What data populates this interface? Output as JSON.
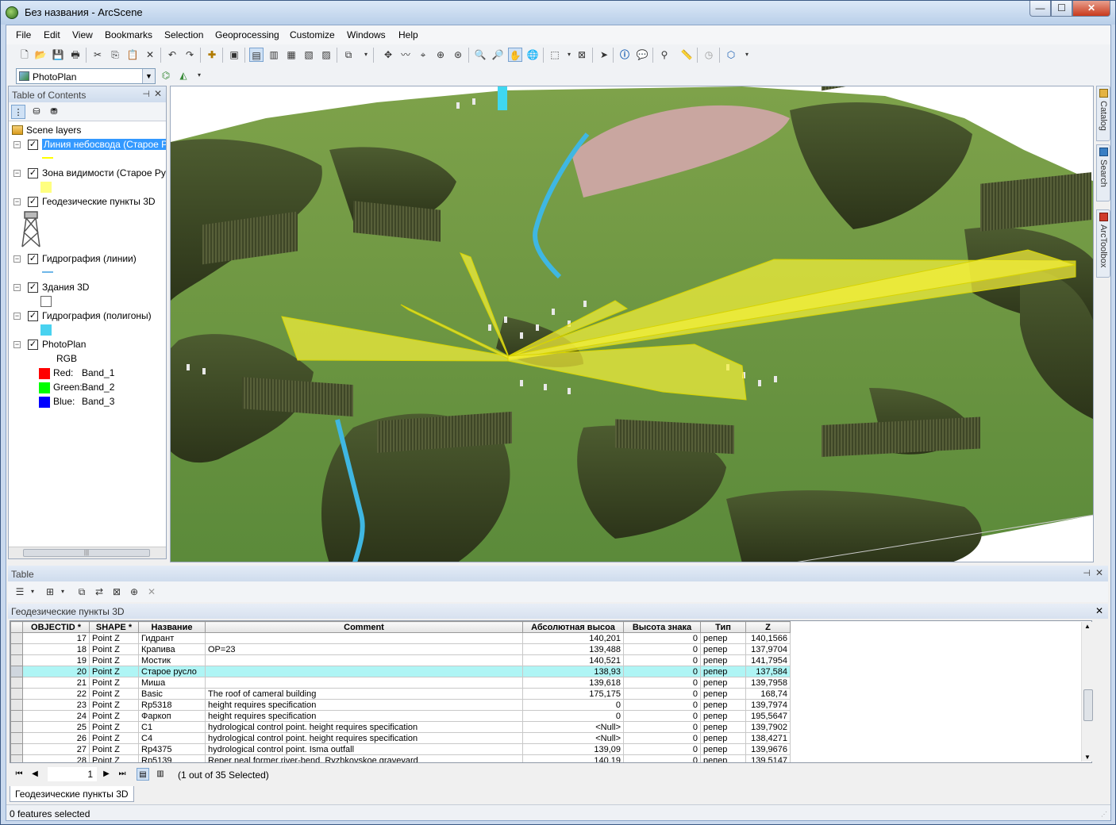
{
  "window": {
    "title": "Без названия - ArcScene",
    "minimize": "—",
    "maximize": "☐",
    "close": "✕"
  },
  "menubar": [
    "File",
    "Edit",
    "View",
    "Bookmarks",
    "Selection",
    "Geoprocessing",
    "Customize",
    "Windows",
    "Help"
  ],
  "layer_selector": {
    "value": "PhotoPlan"
  },
  "toc": {
    "title": "Table of Contents",
    "pin": "⊣",
    "close": "✕",
    "root": "Scene layers",
    "layers": [
      {
        "name": "Линия небосвода (Старое Р",
        "checked": true,
        "selected": true,
        "symbol": "line",
        "color": "#ffff00"
      },
      {
        "name": "Зона видимости (Старое Ру",
        "checked": true,
        "symbol": "fill",
        "color": "#ffff80"
      },
      {
        "name": "Геодезические пункты 3D",
        "checked": true,
        "symbol": "tower",
        "color": "#888888"
      },
      {
        "name": "Гидрография (линии)",
        "checked": true,
        "symbol": "line",
        "color": "#6fb7e8"
      },
      {
        "name": "Здания 3D",
        "checked": true,
        "symbol": "box",
        "color": "#ffffff"
      },
      {
        "name": "Гидрография (полигоны)",
        "checked": true,
        "symbol": "fill",
        "color": "#49d2f0"
      },
      {
        "name": "PhotoPlan",
        "checked": true,
        "symbol": "raster",
        "color": ""
      }
    ],
    "raster": {
      "label": "RGB",
      "bands": [
        {
          "channel": "Red:",
          "band": "Band_1",
          "color": "#ff0000"
        },
        {
          "channel": "Green:",
          "band": "Band_2",
          "color": "#00ff00"
        },
        {
          "channel": "Blue:",
          "band": "Band_3",
          "color": "#0000ff"
        }
      ]
    }
  },
  "right_dock": {
    "tabs": [
      "Catalog",
      "Search",
      "ArcToolbox"
    ]
  },
  "table_pane": {
    "title": "Table",
    "pin": "⊣",
    "close": "✕",
    "layer_title": "Геодезические пункты 3D",
    "columns": [
      "OBJECTID *",
      "SHAPE *",
      "Название",
      "Comment",
      "Абсолютная высоа",
      "Высота знака",
      "Тип",
      "Z"
    ],
    "rows": [
      [
        "17",
        "Point Z",
        "Гидрант",
        "",
        "140,201",
        "0",
        "репер",
        "140,1566"
      ],
      [
        "18",
        "Point Z",
        "Крапива",
        "OP=23",
        "139,488",
        "0",
        "репер",
        "137,9704"
      ],
      [
        "19",
        "Point Z",
        "Мостик",
        "",
        "140,521",
        "0",
        "репер",
        "141,7954"
      ],
      [
        "20",
        "Point Z",
        "Старое русло",
        "",
        "138,93",
        "0",
        "репер",
        "137,584"
      ],
      [
        "21",
        "Point Z",
        "Миша",
        "",
        "139,618",
        "0",
        "репер",
        "139,7958"
      ],
      [
        "22",
        "Point Z",
        "Basic",
        "The roof of cameral building",
        "175,175",
        "0",
        "репер",
        "168,74"
      ],
      [
        "23",
        "Point Z",
        "Rp5318",
        "height requires specification",
        "0",
        "0",
        "репер",
        "139,7974"
      ],
      [
        "24",
        "Point Z",
        "Фаркоп",
        "height requires specification",
        "0",
        "0",
        "репер",
        "195,5647"
      ],
      [
        "25",
        "Point Z",
        "C1",
        "hydrological control point. height requires specification",
        "<Null>",
        "0",
        "репер",
        "139,7902"
      ],
      [
        "26",
        "Point Z",
        "C4",
        "hydrological control point. height requires specification",
        "<Null>",
        "0",
        "репер",
        "138,4271"
      ],
      [
        "27",
        "Point Z",
        "Rp4375",
        "hydrological control point. Isma outfall",
        "139,09",
        "0",
        "репер",
        "139,9676"
      ],
      [
        "28",
        "Point Z",
        "Rp5139",
        "Reper neal former river-bend. Ryzhkovskoe graveyard",
        "140,19",
        "0",
        "репер",
        "139,5147"
      ]
    ],
    "highlight_objectid": "20",
    "record_position": "1",
    "selection_text": "(1 out of 35 Selected)"
  },
  "bottom_tab": "Геодезические пункты 3D",
  "status": "0 features selected"
}
